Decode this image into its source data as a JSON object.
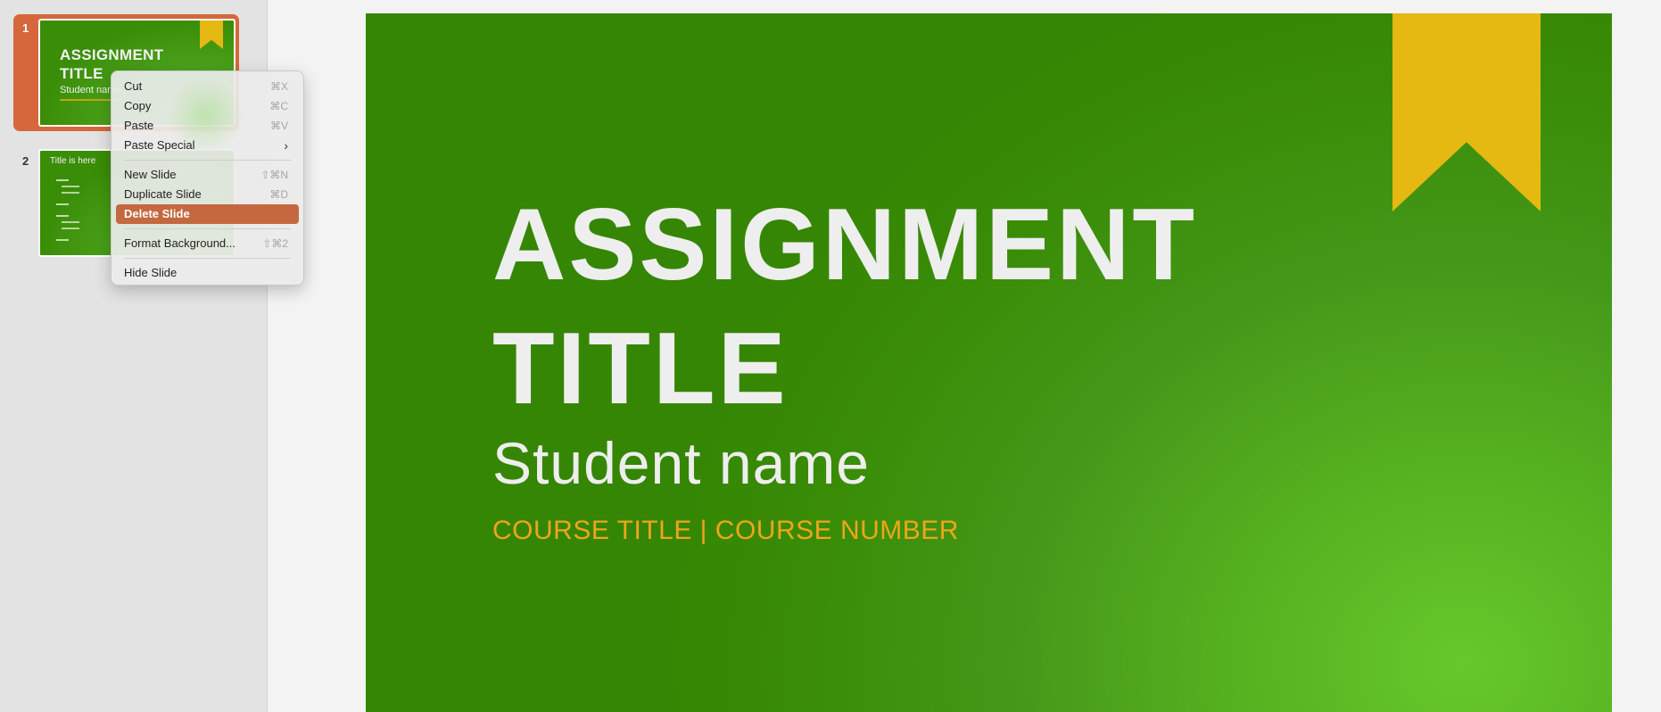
{
  "sidebar": {
    "slides": [
      {
        "number": "1",
        "title": "ASSIGNMENT TITLE",
        "subtitle": "Student name"
      },
      {
        "number": "2",
        "title": "Title is here"
      }
    ]
  },
  "context_menu": {
    "items": [
      {
        "label": "Cut",
        "shortcut": "⌘X"
      },
      {
        "label": "Copy",
        "shortcut": "⌘C"
      },
      {
        "label": "Paste",
        "shortcut": "⌘V"
      },
      {
        "label": "Paste Special",
        "submenu_icon": "chevron-right-icon"
      },
      {
        "label": "New Slide",
        "shortcut": "⇧⌘N"
      },
      {
        "label": "Duplicate Slide",
        "shortcut": "⌘D"
      },
      {
        "label": "Delete Slide",
        "highlighted": true
      },
      {
        "label": "Format Background...",
        "shortcut": "⇧⌘2"
      },
      {
        "label": "Hide Slide"
      }
    ],
    "highlight_color": "#c4683f"
  },
  "slide": {
    "title_line1": "ASSIGNMENT",
    "title_line2": "TITLE",
    "student_name": "Student name",
    "course": "COURSE TITLE |  COURSE NUMBER",
    "colors": {
      "background": "#3a8d07",
      "ribbon": "#e6b812",
      "course_text": "#f0a51a",
      "selection": "#d5673b"
    }
  }
}
